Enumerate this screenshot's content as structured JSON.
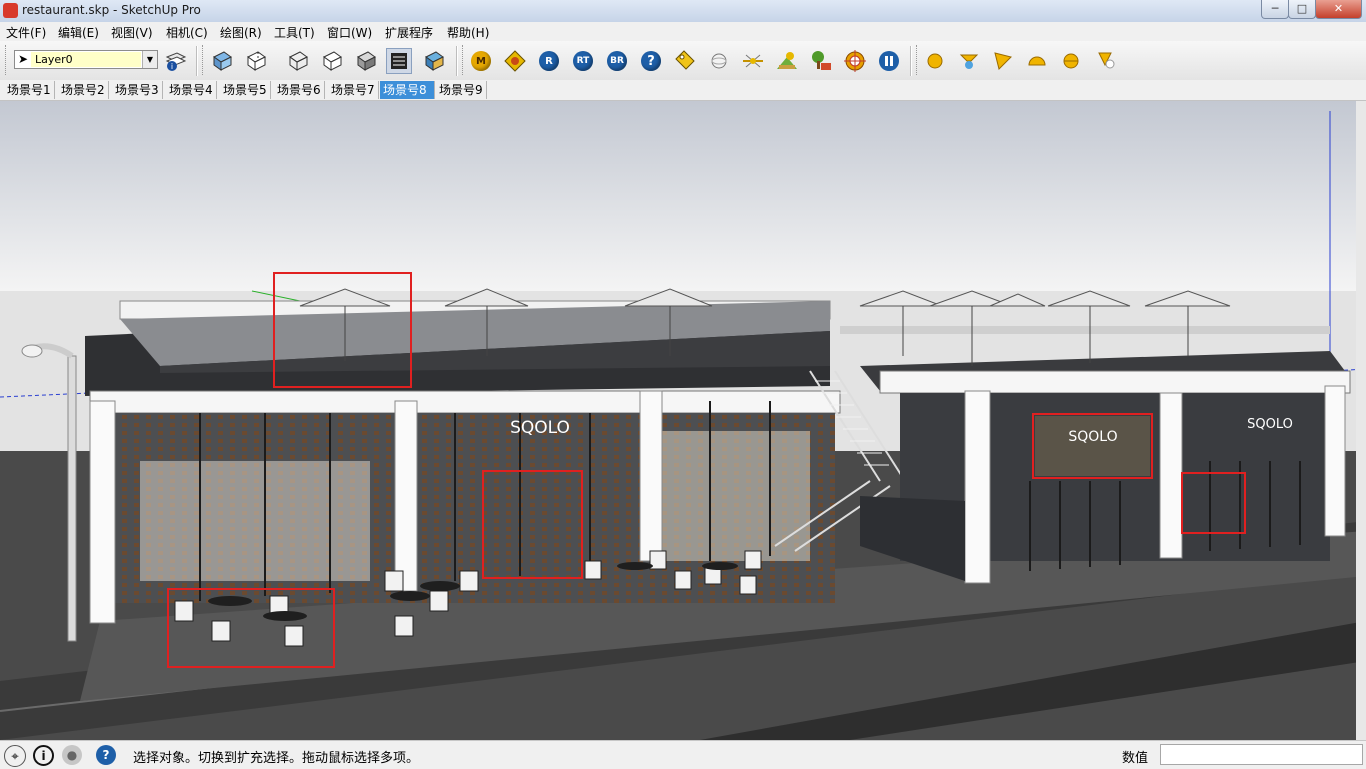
{
  "window": {
    "title": "restaurant.skp - SketchUp Pro",
    "minimize": "─",
    "maximize": "□",
    "close": "✕"
  },
  "menu": [
    "文件(F)",
    "编辑(E)",
    "视图(V)",
    "相机(C)",
    "绘图(R)",
    "工具(T)",
    "窗口(W)",
    "扩展程序",
    "帮助(H)"
  ],
  "toolbar": {
    "layer_value": "Layer0",
    "plugin_letters": {
      "m": "M",
      "r": "R",
      "rt": "RT",
      "br": "BR",
      "help": "?"
    },
    "icons": [
      "select-arrow-icon",
      "layer-manager-icon",
      "xray-style-icon",
      "back-edges-style-icon",
      "wireframe-style-icon",
      "hidden-line-style-icon",
      "shaded-style-icon",
      "shaded-textures-style-icon",
      "monochrome-style-icon",
      "render-m-icon",
      "material-editor-icon",
      "render-r-icon",
      "render-rt-icon",
      "render-br-icon",
      "help-icon",
      "tag-icon",
      "sphere-light-icon",
      "sun-light-icon",
      "environment-icon",
      "tree-proxy-icon",
      "target-icon",
      "pause-icon",
      "omni-light-icon",
      "spot-light-icon",
      "ies-light-icon",
      "dome-light-icon",
      "sphere-light2-icon",
      "mesh-light-icon"
    ]
  },
  "scenes": [
    "场景号1",
    "场景号2",
    "场景号3",
    "场景号4",
    "场景号5",
    "场景号6",
    "场景号7",
    "场景号8",
    "场景号9"
  ],
  "active_scene_index": 7,
  "model": {
    "sign_text": "SQOLO",
    "highlight_color": "#e02020"
  },
  "status": {
    "message": "选择对象。切换到扩充选择。拖动鼠标选择多项。",
    "measurements_label": "数值",
    "measurements_value": ""
  }
}
